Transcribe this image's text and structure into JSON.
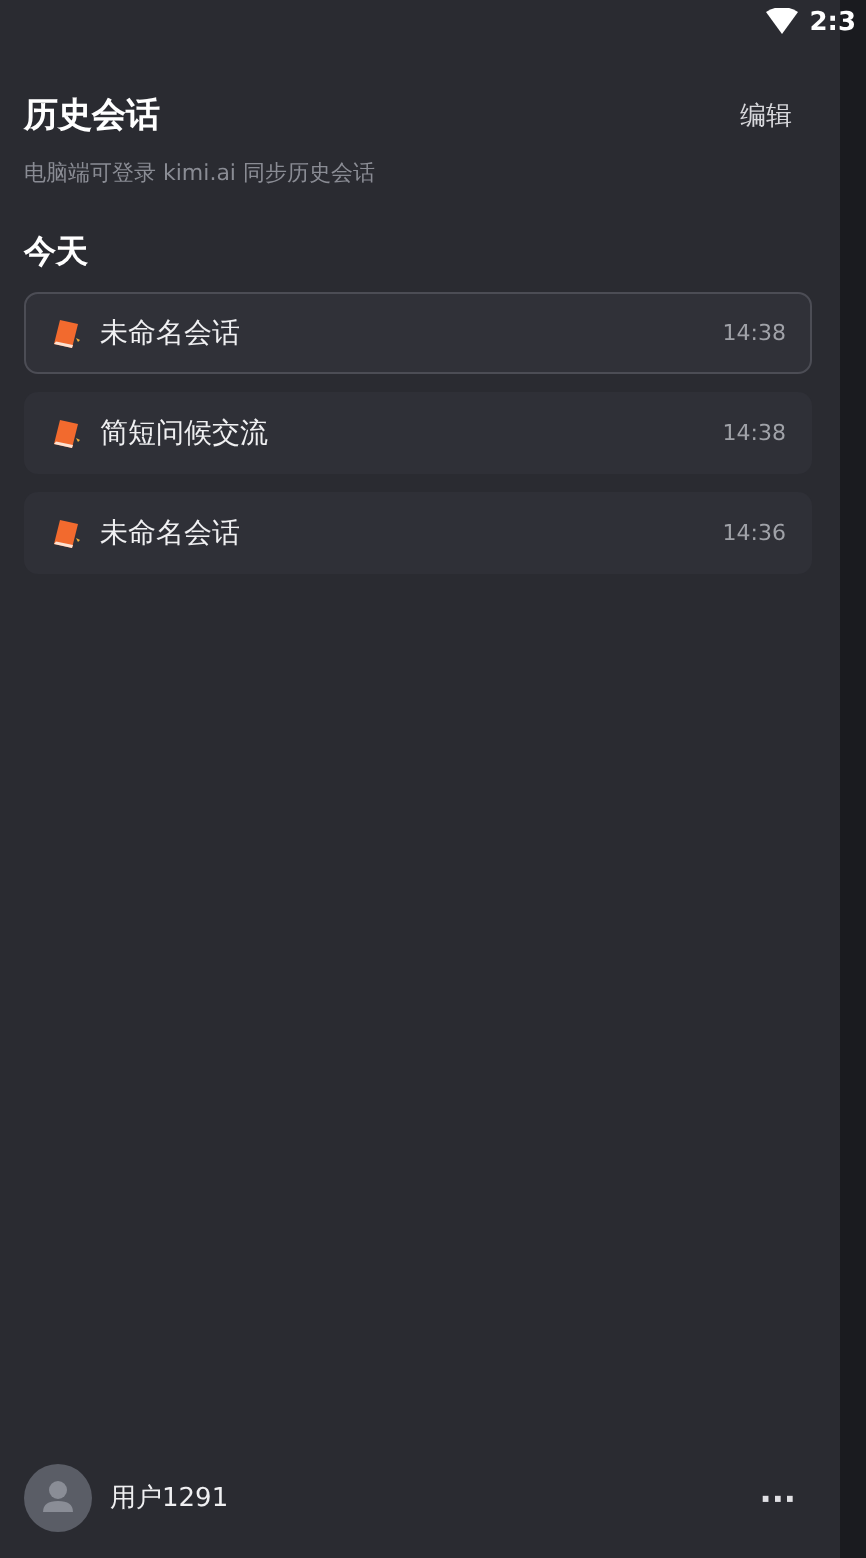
{
  "status_bar": {
    "time": "2:3"
  },
  "header": {
    "title": "历史会话",
    "edit": "编辑",
    "subtitle": "电脑端可登录 kimi.ai 同步历史会话"
  },
  "section": "今天",
  "conversations": [
    {
      "title": "未命名会话",
      "time": "14:38",
      "selected": true
    },
    {
      "title": "简短问候交流",
      "time": "14:38",
      "selected": false
    },
    {
      "title": "未命名会话",
      "time": "14:36",
      "selected": false
    }
  ],
  "footer": {
    "user": "用户1291",
    "more": "···"
  }
}
